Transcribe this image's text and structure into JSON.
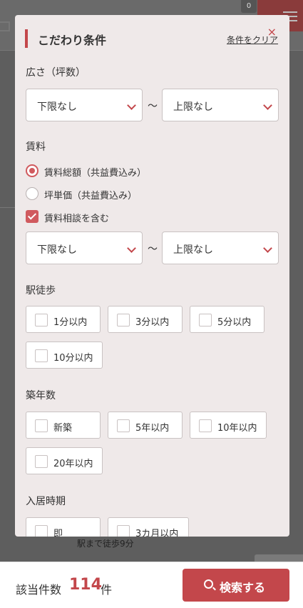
{
  "background": {
    "badge_count": "0",
    "snippet": "駅まで徒歩9分"
  },
  "modal": {
    "title": "こだわり条件",
    "clear_label": "条件をクリア",
    "close_icon": "×",
    "area": {
      "label": "広さ（坪数）",
      "min": "下限なし",
      "separator": "〜",
      "max": "上限なし"
    },
    "rent": {
      "label": "賃料",
      "options": [
        {
          "label": "賃料総額（共益費込み）",
          "selected": true
        },
        {
          "label": "坪単価（共益費込み）",
          "selected": false
        }
      ],
      "negotiable": {
        "label": "賃料相談を含む",
        "checked": true
      },
      "min": "下限なし",
      "separator": "〜",
      "max": "上限なし"
    },
    "walk": {
      "label": "駅徒歩",
      "options": [
        "1分以内",
        "3分以内",
        "5分以内",
        "10分以内"
      ]
    },
    "age": {
      "label": "築年数",
      "options": [
        "新築",
        "5年以内",
        "10年以内",
        "20年以内"
      ]
    },
    "move_in": {
      "label": "入居時期",
      "options": [
        "即",
        "3カ月以内"
      ]
    }
  },
  "footer": {
    "count_label": "該当件数",
    "count": "114",
    "count_unit": "件",
    "search_label": "検索する"
  },
  "colors": {
    "accent": "#c3474b",
    "modal_bg": "#efe9e9",
    "overlay": "#5e5e5e"
  }
}
